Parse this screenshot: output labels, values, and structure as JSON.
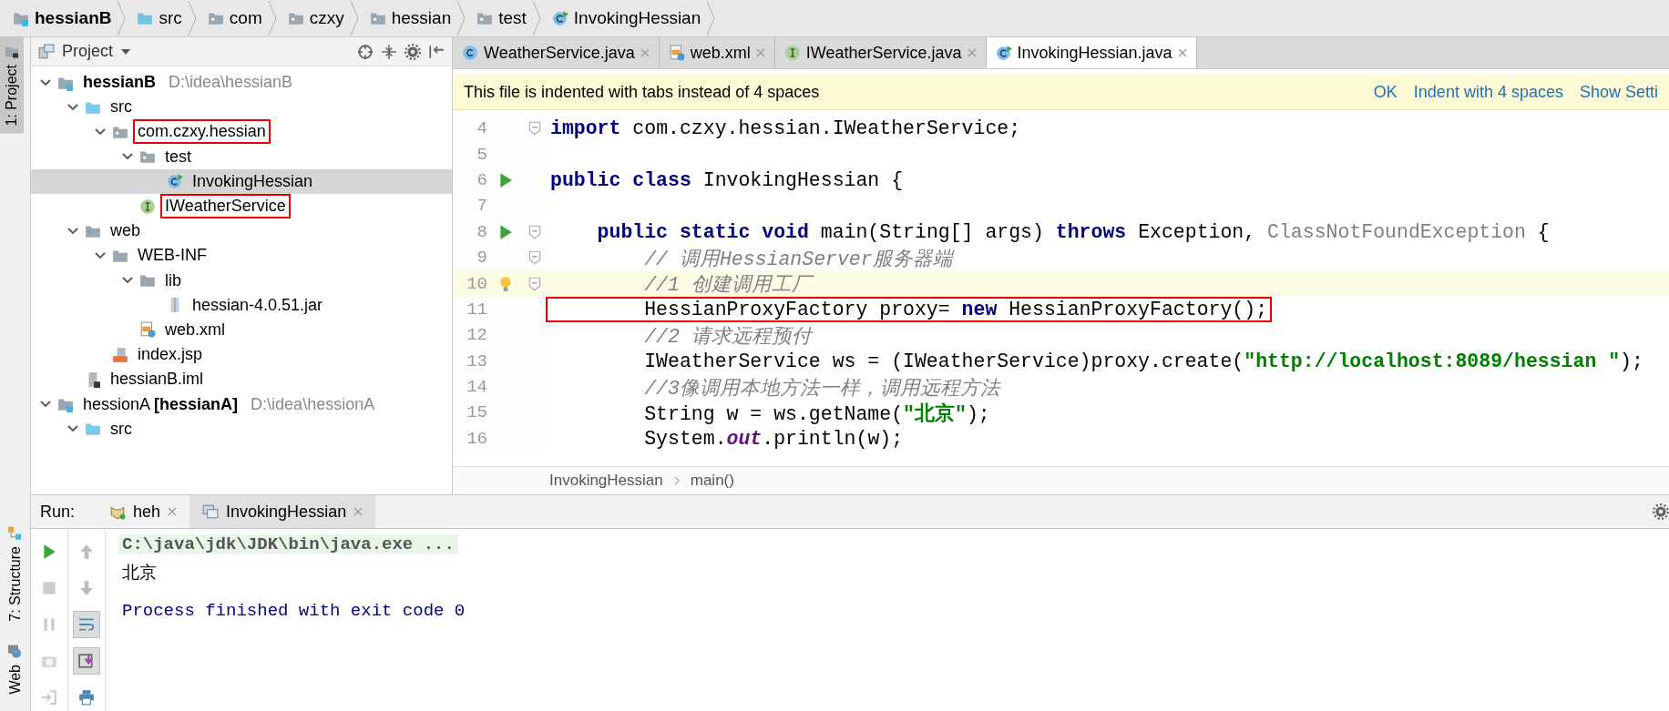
{
  "breadcrumbs": [
    {
      "label": "hessianB",
      "kind": "module",
      "bold": true
    },
    {
      "label": "src",
      "kind": "source-folder",
      "bold": false
    },
    {
      "label": "com",
      "kind": "package",
      "bold": false
    },
    {
      "label": "czxy",
      "kind": "package",
      "bold": false
    },
    {
      "label": "hessian",
      "kind": "package",
      "bold": false
    },
    {
      "label": "test",
      "kind": "package",
      "bold": false
    },
    {
      "label": "InvokingHessian",
      "kind": "class-run",
      "bold": false
    }
  ],
  "tool_strip": {
    "top": [
      {
        "label": "1: Project",
        "kind": "project",
        "selected": true
      }
    ],
    "bottom": [
      {
        "label": "7: Structure",
        "kind": "structure",
        "selected": false
      },
      {
        "label": "Web",
        "kind": "web",
        "selected": false
      }
    ]
  },
  "project": {
    "title": "Project",
    "tree": [
      {
        "label": "hessianB",
        "bold": true,
        "path": "D:\\idea\\hessianB",
        "kind": "module",
        "expanded": true,
        "selected": false,
        "highlighted": false,
        "children": [
          {
            "label": "src",
            "kind": "source-folder",
            "expanded": true,
            "selected": false,
            "highlighted": false,
            "children": [
              {
                "label": "com.czxy.hessian",
                "kind": "package",
                "expanded": true,
                "selected": false,
                "highlighted": true,
                "children": [
                  {
                    "label": "test",
                    "kind": "package",
                    "expanded": true,
                    "selected": false,
                    "highlighted": false,
                    "children": [
                      {
                        "label": "InvokingHessian",
                        "kind": "class-run",
                        "selected": true,
                        "highlighted": false
                      }
                    ]
                  },
                  {
                    "label": "IWeatherService",
                    "kind": "interface",
                    "selected": false,
                    "highlighted": true
                  }
                ]
              }
            ]
          },
          {
            "label": "web",
            "kind": "web-folder",
            "expanded": true,
            "selected": false,
            "highlighted": false,
            "children": [
              {
                "label": "WEB-INF",
                "kind": "folder",
                "expanded": true,
                "selected": false,
                "highlighted": false,
                "children": [
                  {
                    "label": "lib",
                    "kind": "folder",
                    "expanded": true,
                    "selected": false,
                    "highlighted": false,
                    "children": [
                      {
                        "label": "hessian-4.0.51.jar",
                        "kind": "jar",
                        "selected": false,
                        "highlighted": false
                      }
                    ]
                  },
                  {
                    "label": "web.xml",
                    "kind": "xml",
                    "selected": false,
                    "highlighted": false
                  }
                ]
              },
              {
                "label": "index.jsp",
                "kind": "jsp",
                "selected": false,
                "highlighted": false
              }
            ]
          },
          {
            "label": "hessianB.iml",
            "kind": "iml",
            "selected": false,
            "highlighted": false
          }
        ]
      },
      {
        "label": "hessionA **[hessianA]**",
        "bold": false,
        "path": "D:\\idea\\hessionA",
        "kind": "module",
        "expanded": true,
        "selected": false,
        "highlighted": false,
        "children": [
          {
            "label": "src",
            "kind": "source-folder",
            "expanded": true,
            "selected": false,
            "highlighted": false
          }
        ]
      }
    ]
  },
  "editor": {
    "tabs": [
      {
        "label": "WeatherService.java",
        "kind": "class",
        "selected": false
      },
      {
        "label": "web.xml",
        "kind": "xml",
        "selected": false
      },
      {
        "label": "IWeatherService.java",
        "kind": "interface",
        "selected": false
      },
      {
        "label": "InvokingHessian.java",
        "kind": "class-run",
        "selected": true
      }
    ],
    "notice": {
      "message": "This file is indented with tabs instead of 4 spaces",
      "actions": [
        "OK",
        "Indent with 4 spaces",
        "Show Setti"
      ]
    },
    "lines": [
      {
        "number": "4",
        "run": false,
        "bulb": false,
        "fold": true,
        "current": false,
        "highlighted": false,
        "tokens": [
          {
            "kind": "keyword",
            "text": "import"
          },
          {
            "kind": "plain",
            "text": " com.czxy.hessian.IWeatherService;"
          }
        ]
      },
      {
        "number": "5",
        "run": false,
        "bulb": false,
        "fold": false,
        "current": false,
        "highlighted": false
      },
      {
        "number": "6",
        "run": true,
        "bulb": false,
        "fold": false,
        "current": false,
        "highlighted": false,
        "tokens": [
          {
            "kind": "keyword",
            "text": "public class"
          },
          {
            "kind": "plain",
            "text": " InvokingHessian {"
          }
        ]
      },
      {
        "number": "7",
        "run": false,
        "bulb": false,
        "fold": false,
        "current": false,
        "highlighted": false
      },
      {
        "number": "8",
        "run": true,
        "bulb": false,
        "fold": true,
        "current": false,
        "highlighted": false,
        "tokens": [
          {
            "kind": "keyword",
            "text": "    public static void"
          },
          {
            "kind": "plain",
            "text": " main(String[] args) "
          },
          {
            "kind": "keyword",
            "text": "throws"
          },
          {
            "kind": "plain",
            "text": " Exception, "
          },
          {
            "kind": "unused",
            "text": "ClassNotFoundException"
          },
          {
            "kind": "plain",
            "text": " {"
          }
        ]
      },
      {
        "number": "9",
        "run": false,
        "bulb": false,
        "fold": true,
        "current": false,
        "highlighted": false,
        "tokens": [
          {
            "kind": "comment",
            "text": "        // 调用HessianServer服务器端"
          }
        ]
      },
      {
        "number": "10",
        "run": false,
        "bulb": true,
        "fold": true,
        "current": true,
        "highlighted": false,
        "tokens": [
          {
            "kind": "comment",
            "text": "        //1 创建调用工厂"
          }
        ]
      },
      {
        "number": "11",
        "run": false,
        "bulb": false,
        "fold": false,
        "current": false,
        "highlighted": true,
        "tokens": [
          {
            "kind": "plain",
            "text": "        HessianProxyFactory proxy= "
          },
          {
            "kind": "keyword",
            "text": "new"
          },
          {
            "kind": "plain",
            "text": " HessianProxyFactory();"
          }
        ]
      },
      {
        "number": "12",
        "run": false,
        "bulb": false,
        "fold": false,
        "current": false,
        "highlighted": false,
        "tokens": [
          {
            "kind": "comment",
            "text": "        //2 请求远程预付"
          }
        ]
      },
      {
        "number": "13",
        "run": false,
        "bulb": false,
        "fold": false,
        "current": false,
        "highlighted": false,
        "tokens": [
          {
            "kind": "plain",
            "text": "        IWeatherService ws = (IWeatherService)proxy.create("
          },
          {
            "kind": "string",
            "text": "\"http://localhost:8089/hessian \""
          },
          {
            "kind": "plain",
            "text": ");"
          }
        ]
      },
      {
        "number": "14",
        "run": false,
        "bulb": false,
        "fold": false,
        "current": false,
        "highlighted": false,
        "tokens": [
          {
            "kind": "comment",
            "text": "        //3像调用本地方法一样，调用远程方法"
          }
        ]
      },
      {
        "number": "15",
        "run": false,
        "bulb": false,
        "fold": false,
        "current": false,
        "highlighted": false,
        "tokens": [
          {
            "kind": "plain",
            "text": "        String w = ws.getName("
          },
          {
            "kind": "string",
            "text": "\"北京\""
          },
          {
            "kind": "plain",
            "text": ");"
          }
        ]
      },
      {
        "number": "16",
        "run": false,
        "bulb": false,
        "fold": false,
        "current": false,
        "highlighted": false,
        "tokens": [
          {
            "kind": "plain",
            "text": "        System."
          },
          {
            "kind": "field",
            "text": "out"
          },
          {
            "kind": "plain",
            "text": ".println(w);"
          }
        ]
      }
    ],
    "path": [
      "InvokingHessian",
      "main()"
    ]
  },
  "run": {
    "title": "Run:",
    "tabs": [
      {
        "label": "heh",
        "kind": "tomcat",
        "selected": false
      },
      {
        "label": "InvokingHessian",
        "kind": "window",
        "selected": true
      }
    ],
    "tools_left": [
      {
        "kind": "play",
        "disabled": false
      },
      {
        "kind": "stop",
        "disabled": true
      },
      {
        "kind": "pause",
        "disabled": true
      },
      {
        "kind": "camera",
        "disabled": true
      },
      {
        "kind": "exit",
        "disabled": true
      }
    ],
    "tools_right": [
      {
        "kind": "arrow-up",
        "pressed": false
      },
      {
        "kind": "arrow-down",
        "pressed": false
      },
      {
        "kind": "wrap",
        "pressed": true
      },
      {
        "kind": "scroll-end",
        "pressed": true
      },
      {
        "kind": "print",
        "pressed": false
      }
    ],
    "console": [
      {
        "kind": "command",
        "text": "C:\\java\\jdk\\JDK\\bin\\java.exe ..."
      },
      {
        "kind": "output",
        "text": "北京"
      },
      {
        "kind": "status",
        "text": "Process finished with exit code 0"
      }
    ]
  }
}
